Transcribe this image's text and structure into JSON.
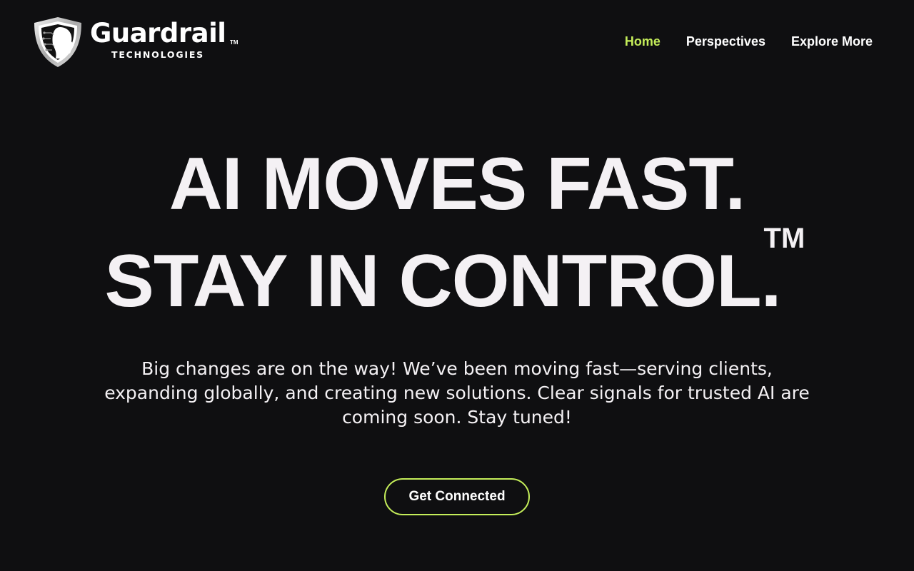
{
  "brand": {
    "name": "Guardrail",
    "tm": "TM",
    "subtitle": "TECHNOLOGIES",
    "logo_icon": "shield-head-icon"
  },
  "nav": {
    "items": [
      {
        "label": "Home",
        "active": true
      },
      {
        "label": "Perspectives",
        "active": false
      },
      {
        "label": "Explore More",
        "active": false
      }
    ]
  },
  "hero": {
    "line1": "AI MOVES FAST.",
    "line2": "STAY IN CONTROL.",
    "tm": "TM",
    "description": "Big changes are on the way! We’ve been moving fast—serving clients, expanding globally, and creating new solutions. Clear signals for trusted AI are coming soon. Stay tuned!",
    "cta_label": "Get Connected"
  },
  "colors": {
    "background": "#0f0f11",
    "accent": "#c5ee5a",
    "text": "#f4f1f4"
  }
}
